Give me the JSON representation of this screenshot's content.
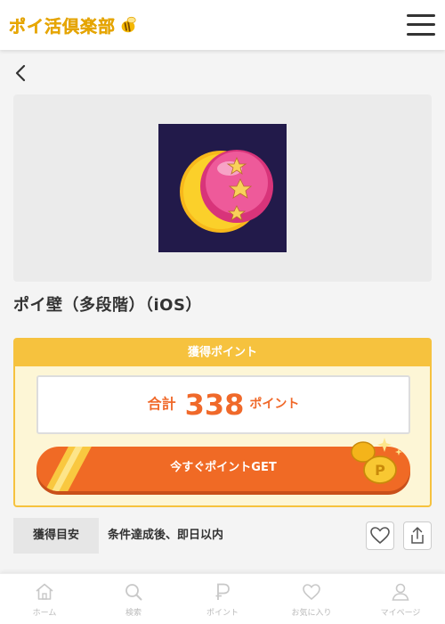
{
  "header": {
    "logo_text": "ポイ活倶楽部",
    "logo_icon": "bee-icon",
    "menu_icon": "hamburger-menu-icon"
  },
  "nav": {
    "back_icon": "chevron-left-icon"
  },
  "hero": {
    "app_icon": "moon-stars-ball-icon"
  },
  "offer": {
    "title": "ポイ壁（多段階）（iOS）"
  },
  "points": {
    "header": "獲得ポイント",
    "prefix": "合計",
    "value": "338",
    "unit": "ポイント",
    "get_button": "今すぐポイントGET"
  },
  "condition": {
    "label": "獲得目安",
    "text": "条件達成後、即日以内"
  },
  "tabs": [
    {
      "label": "ホーム",
      "icon": "home-icon"
    },
    {
      "label": "検索",
      "icon": "search-icon"
    },
    {
      "label": "ポイント",
      "icon": "point-p-icon"
    },
    {
      "label": "お気に入り",
      "icon": "heart-icon"
    },
    {
      "label": "マイページ",
      "icon": "user-icon"
    }
  ],
  "colors": {
    "brand_yellow": "#f6c23e",
    "accent_orange": "#f06a25",
    "points_text": "#f0692a"
  }
}
